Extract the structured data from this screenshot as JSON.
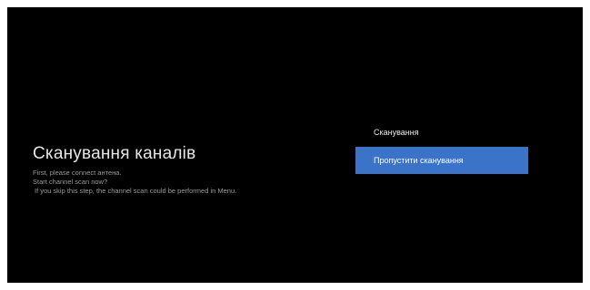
{
  "scan_screen": {
    "title": "Сканування каналів",
    "description": [
      "First, please connect антена.",
      "Start channel scan now?",
      " If you skip this step, the channel scan could be performed in Menu."
    ],
    "options": [
      {
        "label": "Сканування",
        "selected": false
      },
      {
        "label": "Пропустити сканування",
        "selected": true
      }
    ],
    "colors": {
      "background": "#000000",
      "selected": "#3b73c9"
    }
  }
}
